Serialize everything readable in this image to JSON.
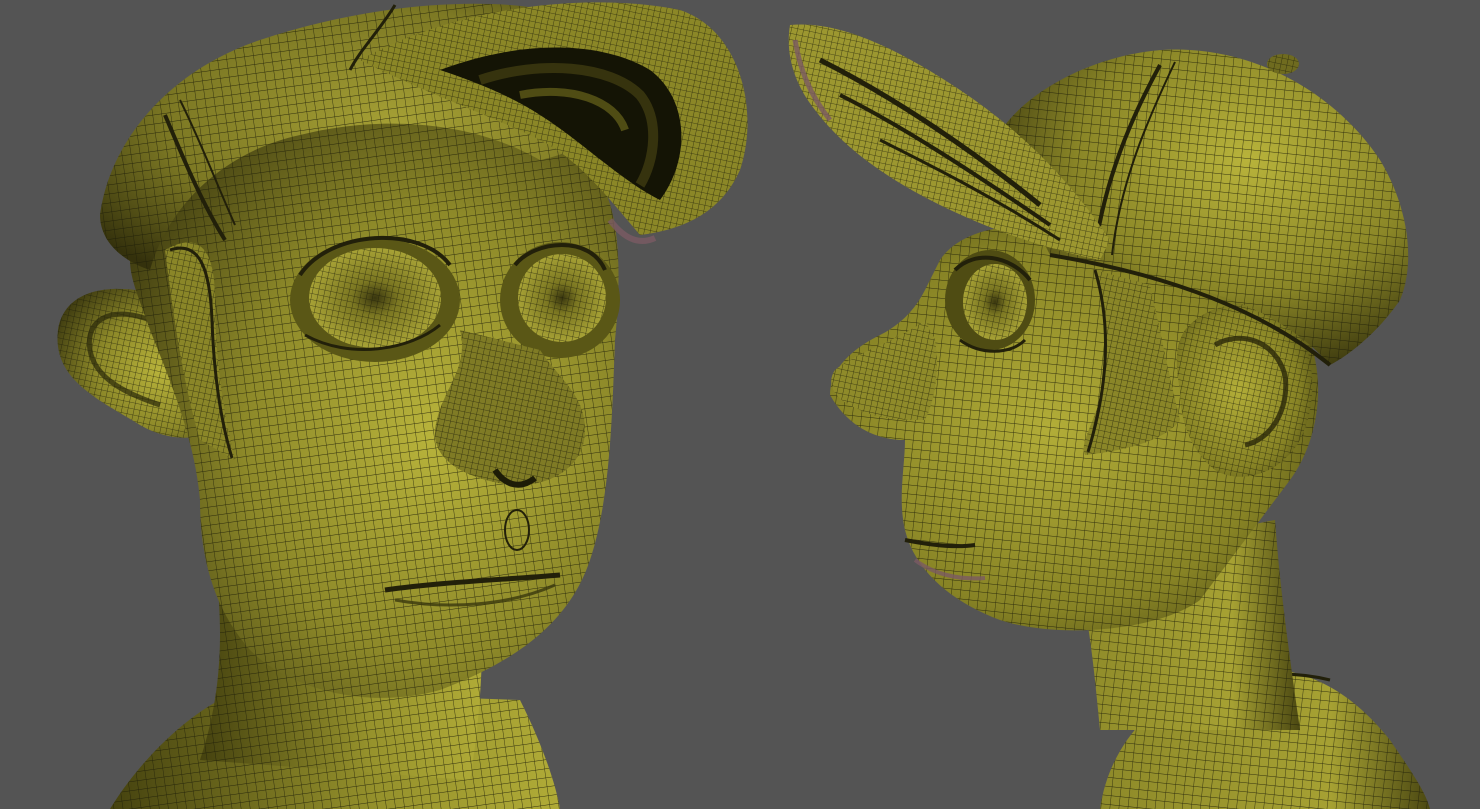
{
  "scene": {
    "description_hidden": "",
    "background_color": "#545454",
    "mesh_color_light": "#b7b23a",
    "mesh_color_mid": "#8f8a2a",
    "mesh_color_dark": "#45420f",
    "wire_color": "#1d1d08",
    "rim_color": "#7a5a63"
  },
  "views": [
    {
      "name": "three-quarter-front-view"
    },
    {
      "name": "side-profile-view"
    }
  ]
}
